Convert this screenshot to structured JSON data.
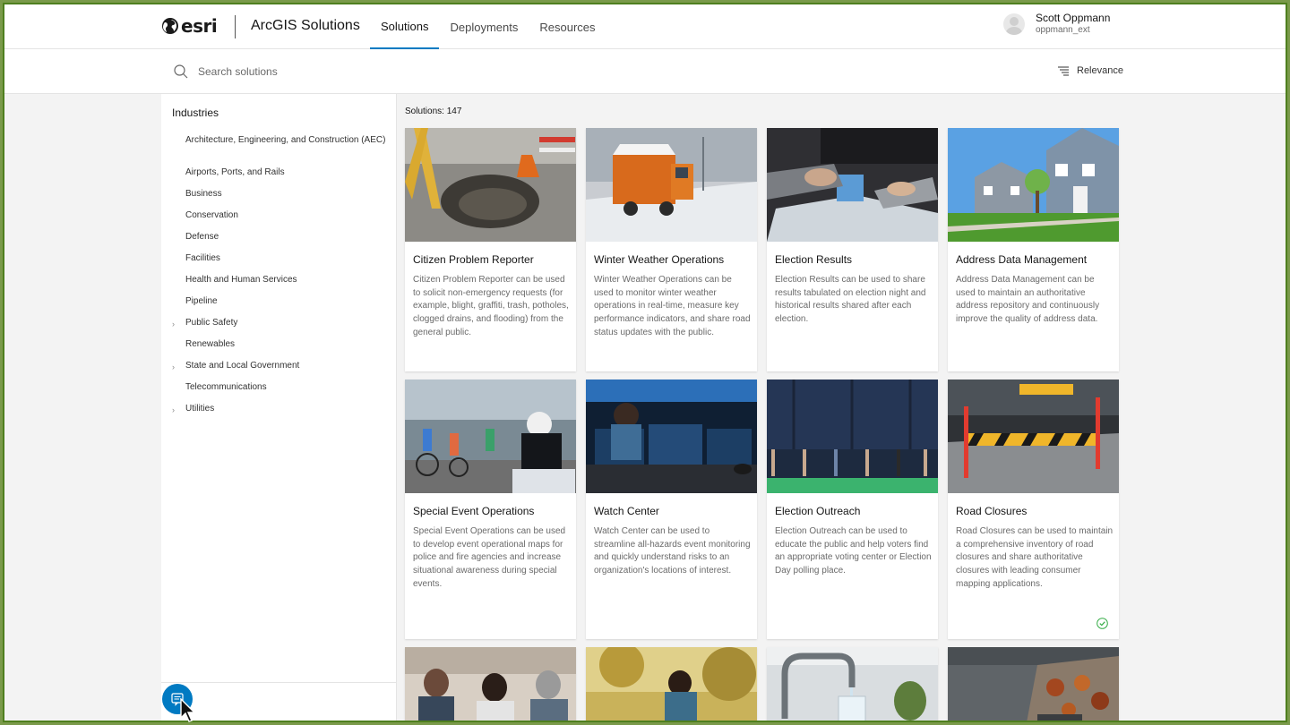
{
  "header": {
    "logo_text": "esri",
    "app_title": "ArcGIS Solutions",
    "nav": [
      {
        "label": "Solutions",
        "active": true
      },
      {
        "label": "Deployments",
        "active": false
      },
      {
        "label": "Resources",
        "active": false
      }
    ],
    "user": {
      "name": "Scott Oppmann",
      "id": "oppmann_ext"
    }
  },
  "search": {
    "placeholder": "Search solutions",
    "value": ""
  },
  "sort": {
    "label": "Relevance",
    "icon": "sort-icon"
  },
  "sidebar": {
    "heading": "Industries",
    "items": [
      {
        "label": "Architecture, Engineering, and Construction (AEC)",
        "expandable": false
      },
      {
        "label": "Airports, Ports, and Rails",
        "expandable": false
      },
      {
        "label": "Business",
        "expandable": false
      },
      {
        "label": "Conservation",
        "expandable": false
      },
      {
        "label": "Defense",
        "expandable": false
      },
      {
        "label": "Facilities",
        "expandable": false
      },
      {
        "label": "Health and Human Services",
        "expandable": false
      },
      {
        "label": "Pipeline",
        "expandable": false
      },
      {
        "label": "Public Safety",
        "expandable": true
      },
      {
        "label": "Renewables",
        "expandable": false
      },
      {
        "label": "State and Local Government",
        "expandable": true
      },
      {
        "label": "Telecommunications",
        "expandable": false
      },
      {
        "label": "Utilities",
        "expandable": true
      }
    ]
  },
  "results": {
    "count_label": "Solutions: 147",
    "cards": [
      {
        "title": "Citizen Problem Reporter",
        "description": "Citizen Problem Reporter can be used to solicit non-emergency requests (for example, blight, graffiti, trash, potholes, clogged drains, and flooding) from the general public.",
        "image": "pothole-photo"
      },
      {
        "title": "Winter Weather Operations",
        "description": "Winter Weather Operations can be used to monitor winter weather operations in real-time, measure key performance indicators, and share road status updates with the public.",
        "image": "snowplow-photo"
      },
      {
        "title": "Election Results",
        "description": "Election Results can be used to share results tabulated on election night and historical results shared after each election.",
        "image": "ballot-box-photo"
      },
      {
        "title": "Address Data Management",
        "description": "Address Data Management can be used to maintain an authoritative address repository and continuously improve the quality of address data.",
        "image": "houses-photo"
      },
      {
        "title": "Special Event Operations",
        "description": "Special Event Operations can be used to develop event operational maps for police and fire agencies and increase situational awareness during special events.",
        "image": "police-cyclists-photo"
      },
      {
        "title": "Watch Center",
        "description": "Watch Center can be used to streamline all-hazards event monitoring and quickly understand risks to an organization's locations of interest.",
        "image": "control-room-photo"
      },
      {
        "title": "Election Outreach",
        "description": "Election Outreach can be used to educate the public and help voters find an appropriate voting center or Election Day polling place.",
        "image": "voting-booths-photo"
      },
      {
        "title": "Road Closures",
        "description": "Road Closures can be used to maintain a comprehensive inventory of road closures and share authoritative closures with leading consumer mapping applications.",
        "image": "road-barrier-photo",
        "deployed": true
      },
      {
        "title": "",
        "description": "",
        "image": "people-meeting-photo"
      },
      {
        "title": "",
        "description": "",
        "image": "child-outdoors-photo"
      },
      {
        "title": "",
        "description": "",
        "image": "water-faucet-photo"
      },
      {
        "title": "",
        "description": "",
        "image": "storm-drain-leaves-photo"
      }
    ]
  },
  "colors": {
    "accent": "#007ac2",
    "frame": "#4f7f1f",
    "background": "#f3f3f3"
  }
}
